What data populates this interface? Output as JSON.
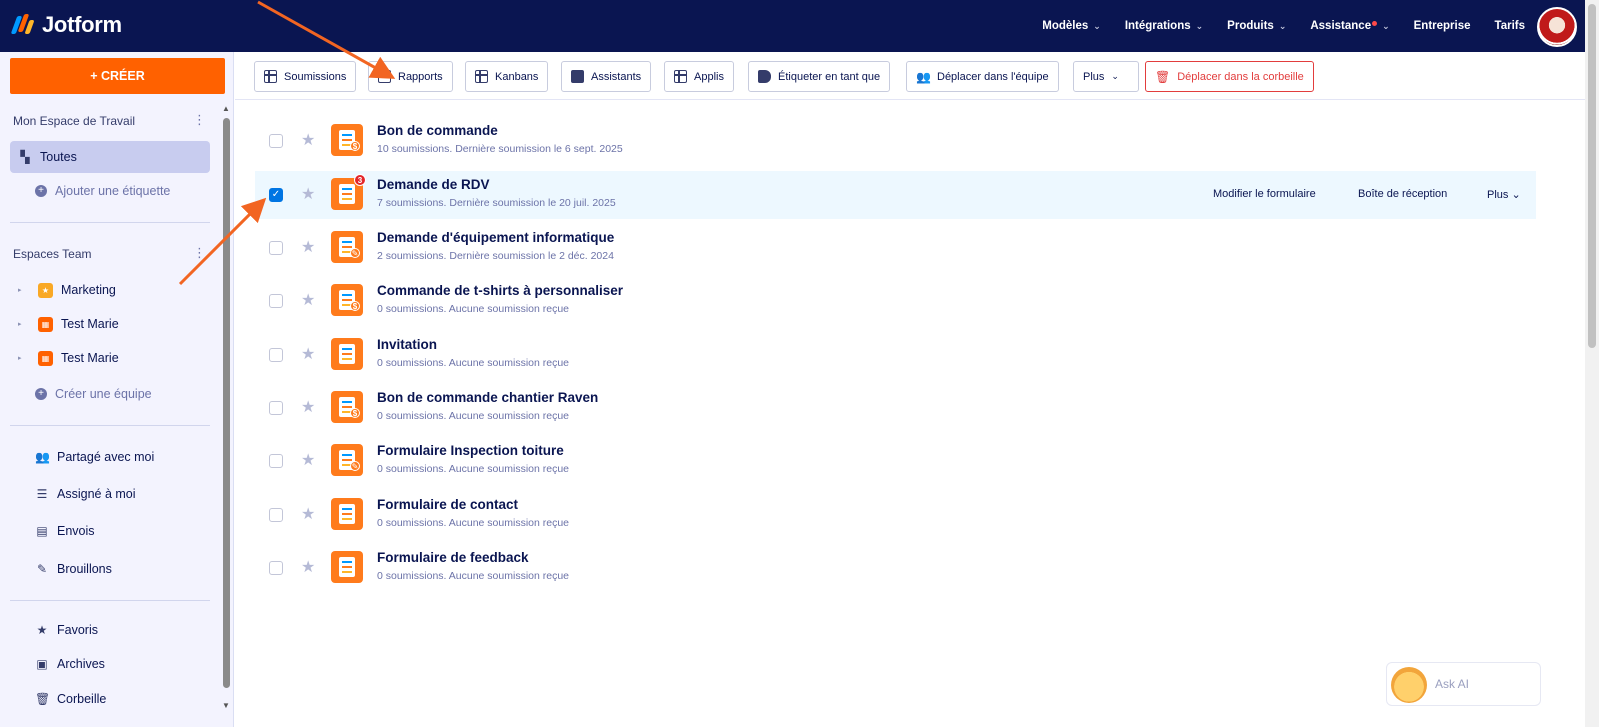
{
  "app": {
    "logo_text": "Jotform"
  },
  "topnav": {
    "items": [
      {
        "label": "Modèles",
        "chevron": true
      },
      {
        "label": "Intégrations",
        "chevron": true
      },
      {
        "label": "Produits",
        "chevron": true
      },
      {
        "label": "Assistance",
        "chevron": true,
        "dot": true
      },
      {
        "label": "Entreprise",
        "chevron": false
      },
      {
        "label": "Tarifs",
        "chevron": false
      }
    ]
  },
  "sidebar": {
    "create_label": "+ CRÉER",
    "workspace_title": "Mon Espace de Travail",
    "all_label": "Toutes",
    "add_label": "Ajouter une étiquette",
    "teams_title": "Espaces Team",
    "teams": [
      {
        "label": "Marketing",
        "color": "#f9a825"
      },
      {
        "label": "Test Marie",
        "color": "#ff6100"
      },
      {
        "label": "Test Marie",
        "color": "#ff6100"
      }
    ],
    "create_team_label": "Créer une équipe",
    "links": [
      {
        "label": "Partagé avec moi",
        "icon": "users-icon"
      },
      {
        "label": "Assigné à moi",
        "icon": "checklist-icon"
      },
      {
        "label": "Envois",
        "icon": "message-icon"
      },
      {
        "label": "Brouillons",
        "icon": "draft-icon"
      }
    ],
    "bottom_links": [
      {
        "label": "Favoris",
        "icon": "star-icon"
      },
      {
        "label": "Archives",
        "icon": "archive-icon"
      },
      {
        "label": "Corbeille",
        "icon": "trash-icon"
      }
    ]
  },
  "toolbar": {
    "submissions": "Soumissions",
    "reports": "Rapports",
    "kanbans": "Kanbans",
    "assistants": "Assistants",
    "apps": "Applis",
    "tag": "Étiqueter en tant que",
    "move_team": "Déplacer dans l'équipe",
    "more": "Plus",
    "trash": "Déplacer dans la corbeille"
  },
  "forms": [
    {
      "title": "Bon de commande",
      "sub": "10 soumissions. Dernière soumission le 6 sept. 2025",
      "badge": "$",
      "checked": false
    },
    {
      "title": "Demande de RDV",
      "sub": "7 soumissions. Dernière soumission le 20 juil. 2025",
      "badge": "",
      "checked": true,
      "notif": "3"
    },
    {
      "title": "Demande d'équipement informatique",
      "sub": "2 soumissions. Dernière soumission le 2 déc. 2024",
      "badge": "✎",
      "checked": false
    },
    {
      "title": "Commande de t-shirts à personnaliser",
      "sub": "0 soumissions. Aucune soumission reçue",
      "badge": "$",
      "checked": false
    },
    {
      "title": "Invitation",
      "sub": "0 soumissions. Aucune soumission reçue",
      "badge": "",
      "checked": false
    },
    {
      "title": "Bon de commande chantier Raven",
      "sub": "0 soumissions. Aucune soumission reçue",
      "badge": "$",
      "checked": false
    },
    {
      "title": "Formulaire Inspection toiture",
      "sub": "0 soumissions. Aucune soumission reçue",
      "badge": "✎",
      "checked": false
    },
    {
      "title": "Formulaire de contact",
      "sub": "0 soumissions. Aucune soumission reçue",
      "badge": "",
      "checked": false
    },
    {
      "title": "Formulaire de feedback",
      "sub": "0 soumissions. Aucune soumission reçue",
      "badge": "",
      "checked": false
    }
  ],
  "row_actions": {
    "edit": "Modifier le formulaire",
    "inbox": "Boîte de réception",
    "more": "Plus"
  },
  "askai": {
    "label": "Ask AI"
  },
  "colors": {
    "navy": "#0a1551",
    "accent": "#ff6100",
    "annotation_arrow": "#f26522",
    "danger": "#e23d3d",
    "selected_row": "#edf8ff"
  }
}
